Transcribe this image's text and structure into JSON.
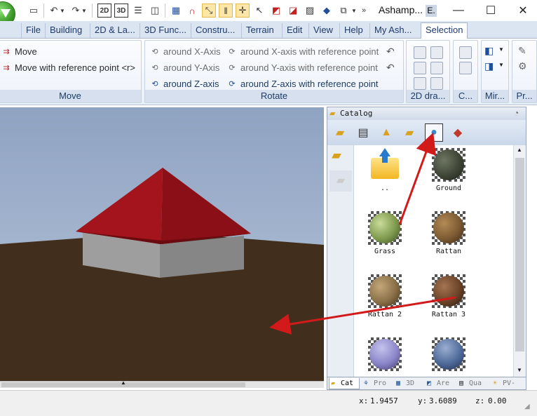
{
  "window": {
    "title": "Ashamp...",
    "title_badge": "E.",
    "controls": {
      "minimize": "—",
      "maximize": "☐",
      "close": "✕"
    }
  },
  "quick_access": {
    "items": [
      "new-doc-icon",
      "undo-icon",
      "redo-icon",
      "view-2d-icon",
      "view-3d-icon",
      "split-horizontal-icon",
      "split-vertical-icon",
      "grid-icon",
      "magnet-icon",
      "select-snap-icon",
      "columns-icon",
      "cross-snap-icon",
      "pointer-icon",
      "transform-icon",
      "color-fill-icon",
      "measure-icon",
      "paint-icon",
      "copy-icon"
    ],
    "labels": {
      "view_2d": "2D",
      "view_3d": "3D"
    }
  },
  "tabs": [
    {
      "label": "File"
    },
    {
      "label": "Building"
    },
    {
      "label": "2D & La..."
    },
    {
      "label": "3D Func..."
    },
    {
      "label": "Constru..."
    },
    {
      "label": "Terrain"
    },
    {
      "label": "Edit"
    },
    {
      "label": "View"
    },
    {
      "label": "Help"
    },
    {
      "label": "My Ash..."
    },
    {
      "label": "Selection",
      "active": true
    }
  ],
  "ribbon": {
    "move_group": {
      "label": "Move",
      "buttons": [
        "Move",
        "Move with reference point <r>"
      ]
    },
    "rotate_group": {
      "label": "Rotate",
      "buttons": [
        "around X-Axis",
        "around Y-Axis",
        "around Z-axis",
        "around X-axis with reference point",
        "around Y-axis with reference point",
        "around Z-axis with reference point"
      ]
    },
    "draw2d_group": {
      "label": "2D dra..."
    },
    "c_group": {
      "label": "C..."
    },
    "mirror_group": {
      "label": "Mir..."
    },
    "pr_group": {
      "label": "Pr..."
    }
  },
  "catalog": {
    "title": "Catalog",
    "items": [
      {
        "label": "..",
        "icon": "folder-up-icon"
      },
      {
        "label": "Ground",
        "color": "#3f4536"
      },
      {
        "label": "Grass",
        "color": "#7e9a4e"
      },
      {
        "label": "Rattan",
        "color": "#7d5a32"
      },
      {
        "label": "Rattan 2",
        "color": "#8a7048"
      },
      {
        "label": "Rattan 3",
        "color": "#6a4328"
      },
      {
        "label": "",
        "color": "#8b86c8"
      },
      {
        "label": "",
        "color": "#4f6a9a"
      }
    ],
    "bottom_tabs": [
      {
        "label": "Cat",
        "active": true
      },
      {
        "label": "Pro"
      },
      {
        "label": "3D"
      },
      {
        "label": "Are"
      },
      {
        "label": "Qua"
      },
      {
        "label": "PV-"
      }
    ]
  },
  "status": {
    "x_label": "x:",
    "x_value": "1.9457",
    "y_label": "y:",
    "y_value": "3.6089",
    "z_label": "z:",
    "z_value": "0.00"
  },
  "colors": {
    "roof": "#a3141c",
    "wall": "#a8a8a8",
    "ground": "#422e1c",
    "arrow": "#d21a1a"
  }
}
